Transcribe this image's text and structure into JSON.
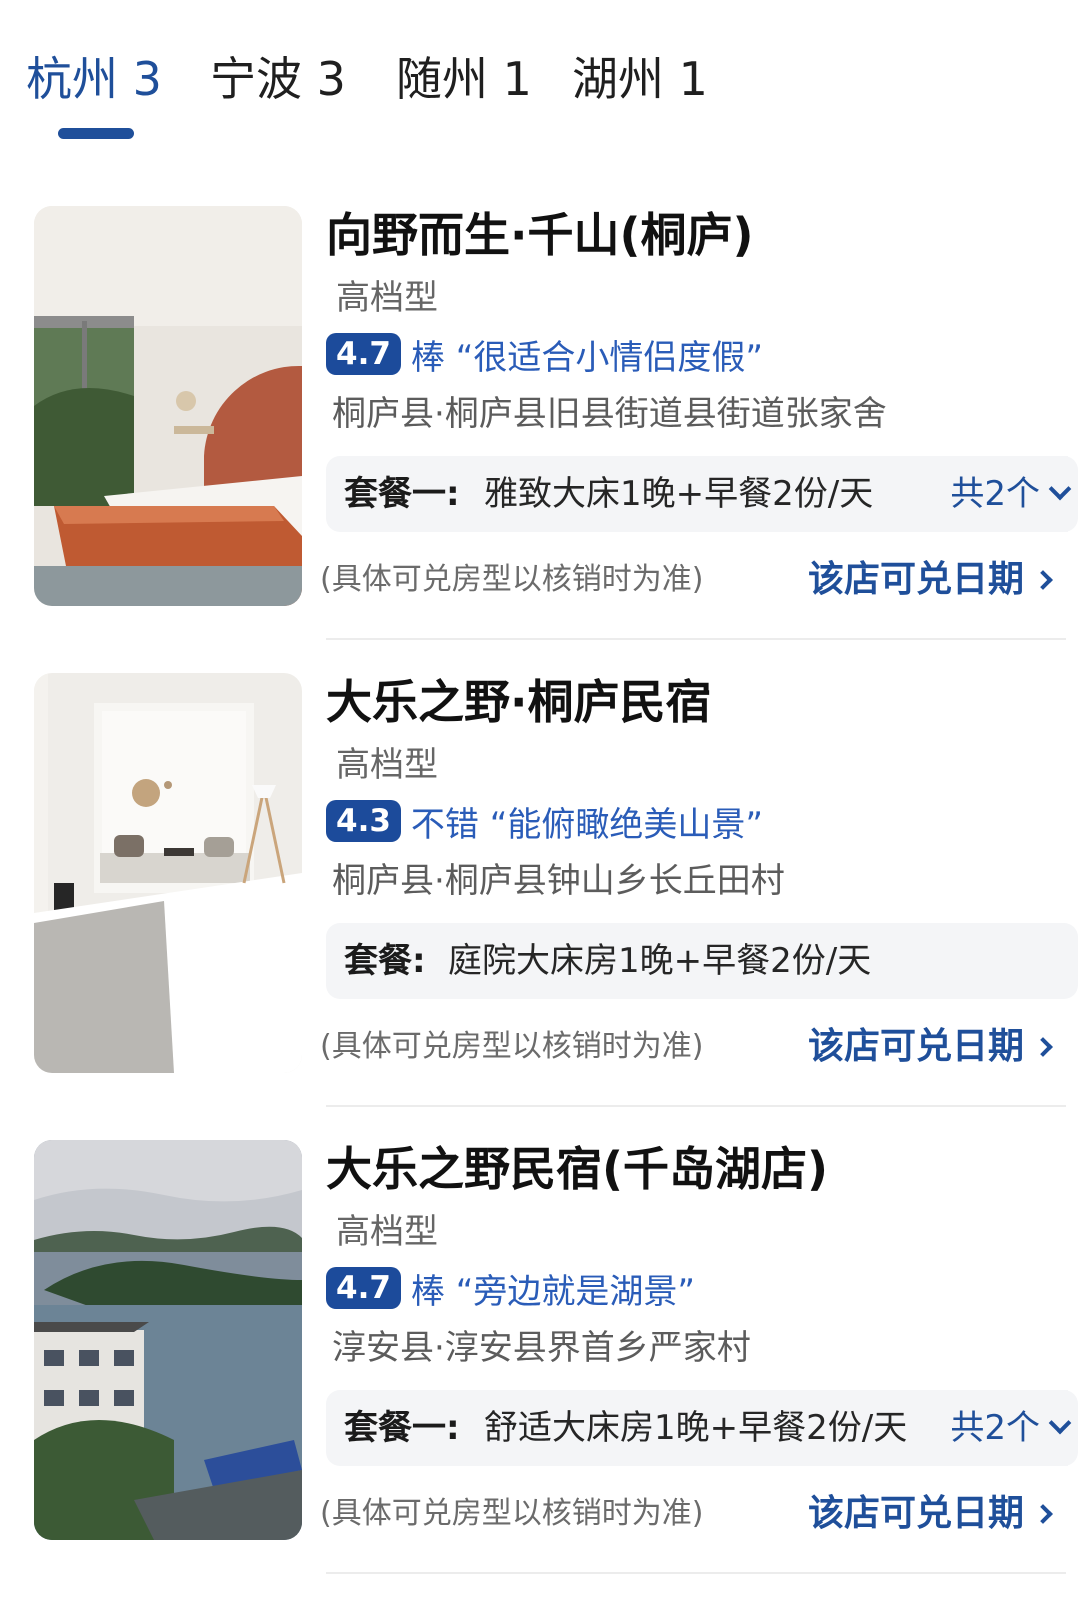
{
  "tabs": [
    {
      "label": "杭州 3",
      "active": true
    },
    {
      "label": "宁波 3",
      "active": false
    },
    {
      "label": "随州 1",
      "active": false
    },
    {
      "label": "湖州 1",
      "active": false
    }
  ],
  "colors": {
    "accent": "#1f4f9a",
    "score_badge": "#1c4b9b",
    "rating_text": "#2a5cb8",
    "package_bg": "#f4f5f7"
  },
  "hotels": [
    {
      "name": "向野而生·千山(桐庐)",
      "grade": "高档型",
      "score": "4.7",
      "review": "棒 “很适合小情侣度假”",
      "address": "桐庐县·桐庐县旧县街道县街道张家舍",
      "package_label": "套餐一:",
      "package_desc": "雅致大床1晚+早餐2份/天",
      "package_count": "共2个",
      "note": "(具体可兑房型以核销时为准)",
      "dates_link": "该店可兑日期",
      "image": "hotel-room-photo"
    },
    {
      "name": "大乐之野·桐庐民宿",
      "grade": "高档型",
      "score": "4.3",
      "review": "不错 “能俯瞰绝美山景”",
      "address": "桐庐县·桐庐县钟山乡长丘田村",
      "package_label": "套餐:",
      "package_desc": "庭院大床房1晚+早餐2份/天",
      "package_count": "",
      "note": "(具体可兑房型以核销时为准)",
      "dates_link": "该店可兑日期",
      "image": "hotel-room-photo"
    },
    {
      "name": "大乐之野民宿(千岛湖店)",
      "grade": "高档型",
      "score": "4.7",
      "review": "棒 “旁边就是湖景”",
      "address": "淳安县·淳安县界首乡严家村",
      "package_label": "套餐一:",
      "package_desc": "舒适大床房1晚+早餐2份/天",
      "package_count": "共2个",
      "note": "(具体可兑房型以核销时为准)",
      "dates_link": "该店可兑日期",
      "image": "lake-view-photo"
    }
  ]
}
